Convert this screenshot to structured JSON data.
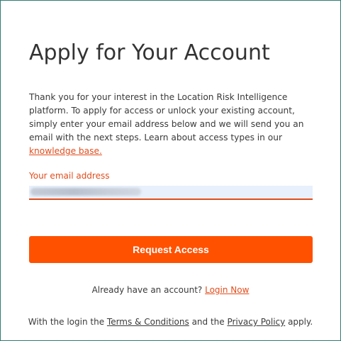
{
  "title": "Apply for Your Account",
  "intro": {
    "text": "Thank you for your interest in the Location Risk Intelligence platform. To apply for access or unlock your existing account, simply enter your email address below and we will send you an email with the next steps. Learn about access types in our ",
    "link_label": "knowledge base."
  },
  "email_field": {
    "label": "Your email address",
    "value": ""
  },
  "submit_button": {
    "label": "Request Access"
  },
  "login_prompt": {
    "text": "Already have an account? ",
    "link_label": "Login Now"
  },
  "legal": {
    "prefix": "With the login the ",
    "terms_label": "Terms & Conditions",
    "middle": " and the ",
    "privacy_label": "Privacy Policy",
    "suffix": " apply."
  },
  "colors": {
    "accent": "#ff5100",
    "link": "#e24d1c",
    "frame_border": "#2e7d74",
    "input_background": "#e8f0fd"
  }
}
